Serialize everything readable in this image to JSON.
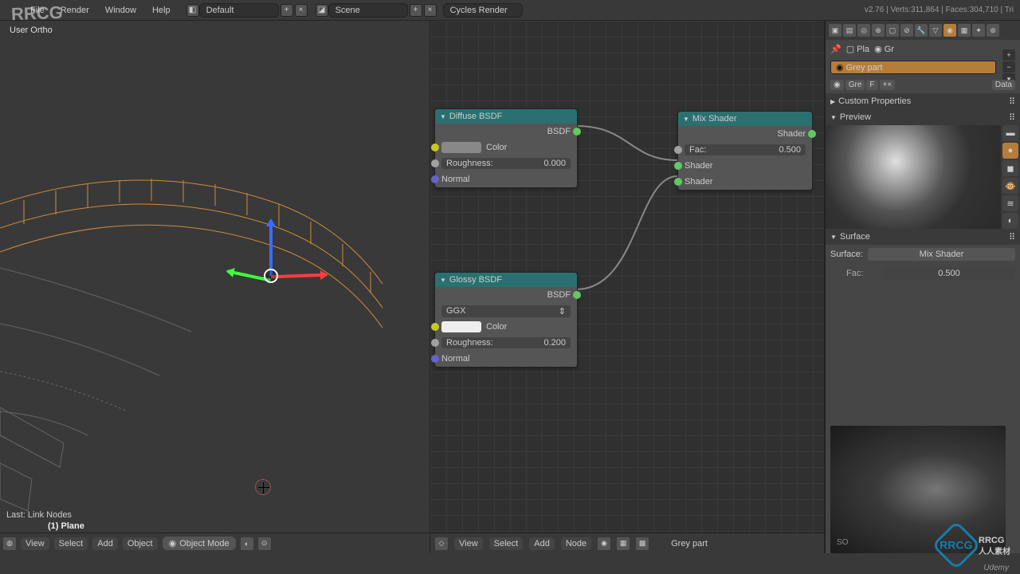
{
  "topbar": {
    "menus": [
      "File",
      "Render",
      "Window",
      "Help"
    ],
    "layout": "Default",
    "scene": "Scene",
    "engine": "Cycles Render",
    "version_stats": "v2.76 | Verts:311,864 | Faces:304,710 | Tri"
  },
  "viewport": {
    "view_label": "User Ortho",
    "last_operator": "Last: Link Nodes",
    "object_name": "(1) Plane",
    "header": {
      "menus": [
        "View",
        "Select",
        "Add",
        "Object"
      ],
      "mode": "Object Mode"
    }
  },
  "node_editor": {
    "nodes": {
      "diffuse": {
        "title": "Diffuse BSDF",
        "output": "BSDF",
        "color_label": "Color",
        "roughness_label": "Roughness:",
        "roughness_value": "0.000",
        "normal_label": "Normal"
      },
      "glossy": {
        "title": "Glossy BSDF",
        "output": "BSDF",
        "distribution": "GGX",
        "color_label": "Color",
        "roughness_label": "Roughness:",
        "roughness_value": "0.200",
        "normal_label": "Normal"
      },
      "mix": {
        "title": "Mix Shader",
        "output": "Shader",
        "fac_label": "Fac:",
        "fac_value": "0.500",
        "shader1": "Shader",
        "shader2": "Shader"
      }
    },
    "footer": {
      "menus": [
        "View",
        "Select",
        "Add",
        "Node"
      ],
      "material": "Grey part"
    }
  },
  "properties": {
    "object_breadcrumb": {
      "obj": "Pla",
      "mat": "Gr"
    },
    "material_slot": "Grey part",
    "mat_link": {
      "name": "Gre",
      "users": "F",
      "data": "Data"
    },
    "panels": {
      "custom": "Custom Properties",
      "preview": "Preview",
      "surface": "Surface"
    },
    "surface": {
      "label": "Surface:",
      "value": "Mix Shader",
      "fac_label": "Fac:",
      "fac_value": "0.500"
    }
  },
  "watermark": "RRCG",
  "watermark_cn": "人人素材",
  "ref_brand": "SO",
  "udemy": "Udemy"
}
